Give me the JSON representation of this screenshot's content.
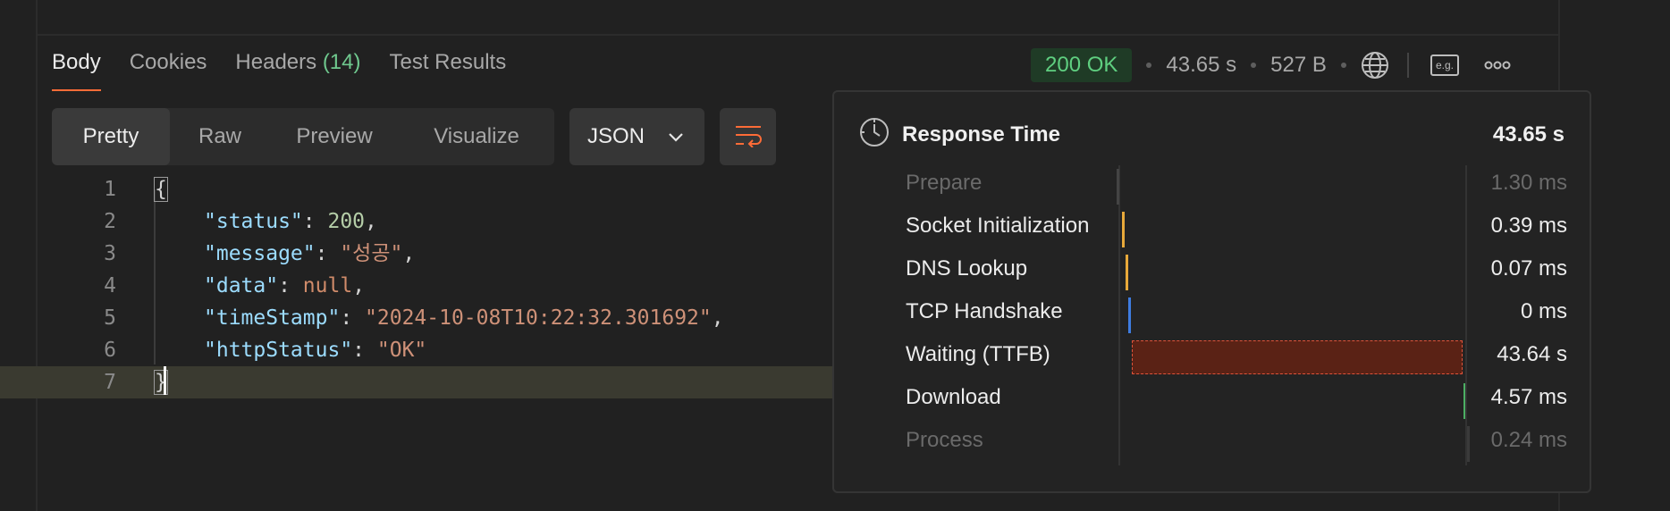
{
  "tabs": [
    {
      "label": "Body"
    },
    {
      "label": "Cookies"
    },
    {
      "label": "Headers",
      "count": "(14)"
    },
    {
      "label": "Test Results"
    }
  ],
  "meta": {
    "status": "200 OK",
    "time": "43.65 s",
    "size": "527 B"
  },
  "view_modes": [
    "Pretty",
    "Raw",
    "Preview",
    "Visualize"
  ],
  "format_select": "JSON",
  "code": {
    "line_numbers": [
      "1",
      "2",
      "3",
      "4",
      "5",
      "6",
      "7"
    ],
    "lines": [
      {
        "text": "{"
      },
      {
        "key": "\"status\"",
        "colon": ": ",
        "value": "200",
        "trail": ","
      },
      {
        "key": "\"message\"",
        "colon": ": ",
        "value": "\"성공\"",
        "trail": ","
      },
      {
        "key": "\"data\"",
        "colon": ": ",
        "value": "null",
        "trail": ","
      },
      {
        "key": "\"timeStamp\"",
        "colon": ": ",
        "value": "\"2024-10-08T10:22:32.301692\"",
        "trail": ","
      },
      {
        "key": "\"httpStatus\"",
        "colon": ": ",
        "value": "\"OK\"",
        "trail": ""
      },
      {
        "text": "}"
      }
    ]
  },
  "response_time": {
    "title": "Response Time",
    "total": "43.65 s",
    "phases": [
      {
        "label": "Prepare",
        "value": "1.30 ms",
        "color": "#444444"
      },
      {
        "label": "Socket Initialization",
        "value": "0.39 ms",
        "color": "#e8a93a"
      },
      {
        "label": "DNS Lookup",
        "value": "0.07 ms",
        "color": "#e8a93a"
      },
      {
        "label": "TCP Handshake",
        "value": "0 ms",
        "color": "#3e7ce0"
      },
      {
        "label": "Waiting (TTFB)",
        "value": "43.64 s",
        "color": "#5a2215"
      },
      {
        "label": "Download",
        "value": "4.57 ms",
        "color": "#4caf63"
      },
      {
        "label": "Process",
        "value": "0.24 ms",
        "color": "#3a3a3a"
      }
    ]
  }
}
